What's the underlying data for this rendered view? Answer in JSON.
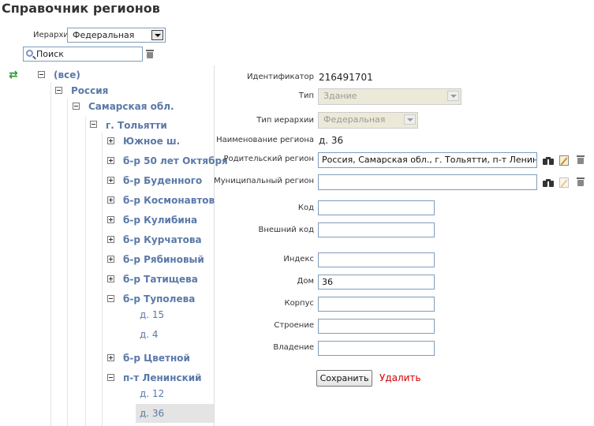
{
  "page": {
    "title": "Справочник регионов"
  },
  "filter": {
    "hierarchy_label": "Иерархия",
    "hierarchy_value": "Федеральная",
    "search_value": "Поиск"
  },
  "tree": {
    "all": "(все)",
    "russia": "Россия",
    "samara": "Самарская обл.",
    "tolyatti": "г. Тольятти",
    "nodes": [
      "Южное ш.",
      "б-р 50 лет Октября",
      "б-р Буденного",
      "б-р Космонавтов",
      "б-р Кулибина",
      "б-р Курчатова",
      "б-р Рябиновый",
      "б-р Татищева",
      "б-р Туполева"
    ],
    "tupoleva_children": [
      "д. 15",
      "д. 4"
    ],
    "tsvetnoy": "б-р Цветной",
    "leninsky": "п-т Ленинский",
    "leninsky_children": [
      "д. 12",
      "д. 36"
    ]
  },
  "form": {
    "id_label": "Идентификатор",
    "id_value": "216491701",
    "type_label": "Тип",
    "type_value": "Здание",
    "hier_type_label": "Тип иерархии",
    "hier_type_value": "Федеральная",
    "name_label": "Наименование региона",
    "name_value": "д. 36",
    "parent_label": "Родительский регион",
    "parent_value": "Россия, Самарская обл., г. Тольятти, п-т Ленинский",
    "municipal_label": "Муниципальный регион",
    "municipal_value": "",
    "code_label": "Код",
    "code_value": "",
    "extcode_label": "Внешний код",
    "extcode_value": "",
    "index_label": "Индекс",
    "index_value": "",
    "house_label": "Дом",
    "house_value": "36",
    "korpus_label": "Корпус",
    "korpus_value": "",
    "stroenie_label": "Строение",
    "stroenie_value": "",
    "vladenie_label": "Владение",
    "vladenie_value": "",
    "save_label": "Сохранить",
    "delete_label": "Удалить"
  },
  "icons": [
    "refresh-icon",
    "search-icon",
    "trash-icon",
    "binoculars-icon",
    "edit-icon"
  ],
  "colors": {
    "tree_link": "#5a79a8",
    "delete_link": "#cc0000"
  }
}
